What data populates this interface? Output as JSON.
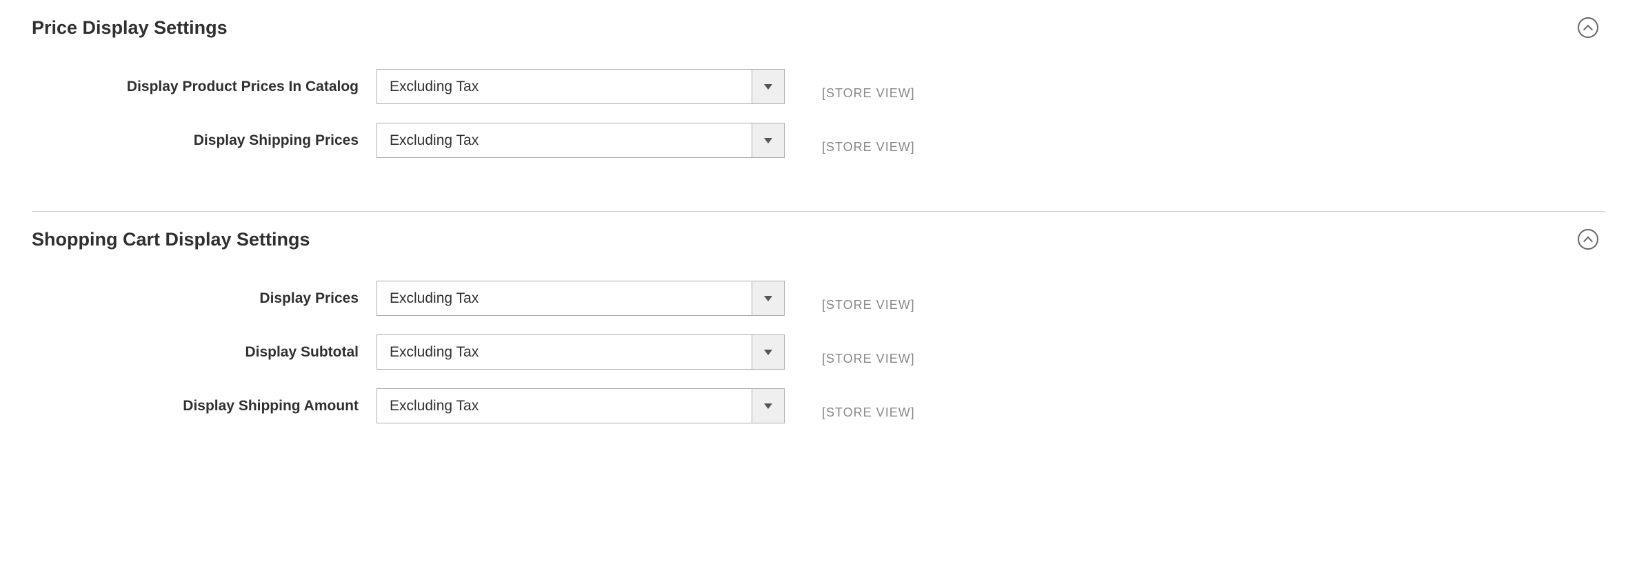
{
  "sections": {
    "price_display": {
      "title": "Price Display Settings",
      "fields": {
        "catalog": {
          "label": "Display Product Prices In Catalog",
          "value": "Excluding Tax",
          "scope": "[STORE VIEW]"
        },
        "shipping": {
          "label": "Display Shipping Prices",
          "value": "Excluding Tax",
          "scope": "[STORE VIEW]"
        }
      }
    },
    "cart_display": {
      "title": "Shopping Cart Display Settings",
      "fields": {
        "prices": {
          "label": "Display Prices",
          "value": "Excluding Tax",
          "scope": "[STORE VIEW]"
        },
        "subtotal": {
          "label": "Display Subtotal",
          "value": "Excluding Tax",
          "scope": "[STORE VIEW]"
        },
        "shipping_amount": {
          "label": "Display Shipping Amount",
          "value": "Excluding Tax",
          "scope": "[STORE VIEW]"
        }
      }
    }
  }
}
